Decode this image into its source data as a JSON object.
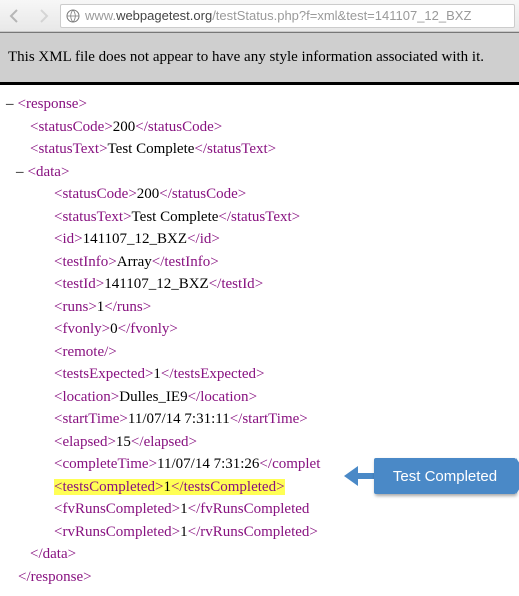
{
  "browser": {
    "url_prefix": "www.",
    "url_host": "webpagetest.org",
    "url_path": "/testStatus.php?f=xml&test=141107_12_BXZ"
  },
  "banner": "This XML file does not appear to have any style information associated with it.",
  "xml": {
    "root": "response",
    "statusCode": "200",
    "statusText": "Test Complete",
    "data_tag": "data",
    "data": {
      "statusCode": "200",
      "statusText": "Test Complete",
      "id": "141107_12_BXZ",
      "testInfo": "Array",
      "testId": "141107_12_BXZ",
      "runs": "1",
      "fvonly": "0",
      "remote_selfclose": "remote",
      "testsExpected": "1",
      "location": "Dulles_IE9",
      "startTime": "11/07/14 7:31:11",
      "elapsed": "15",
      "completeTime": "11/07/14 7:31:26",
      "testsCompleted": "1",
      "fvRunsCompleted": "1",
      "rvRunsCompleted": "1"
    }
  },
  "callout": "Test Completed"
}
